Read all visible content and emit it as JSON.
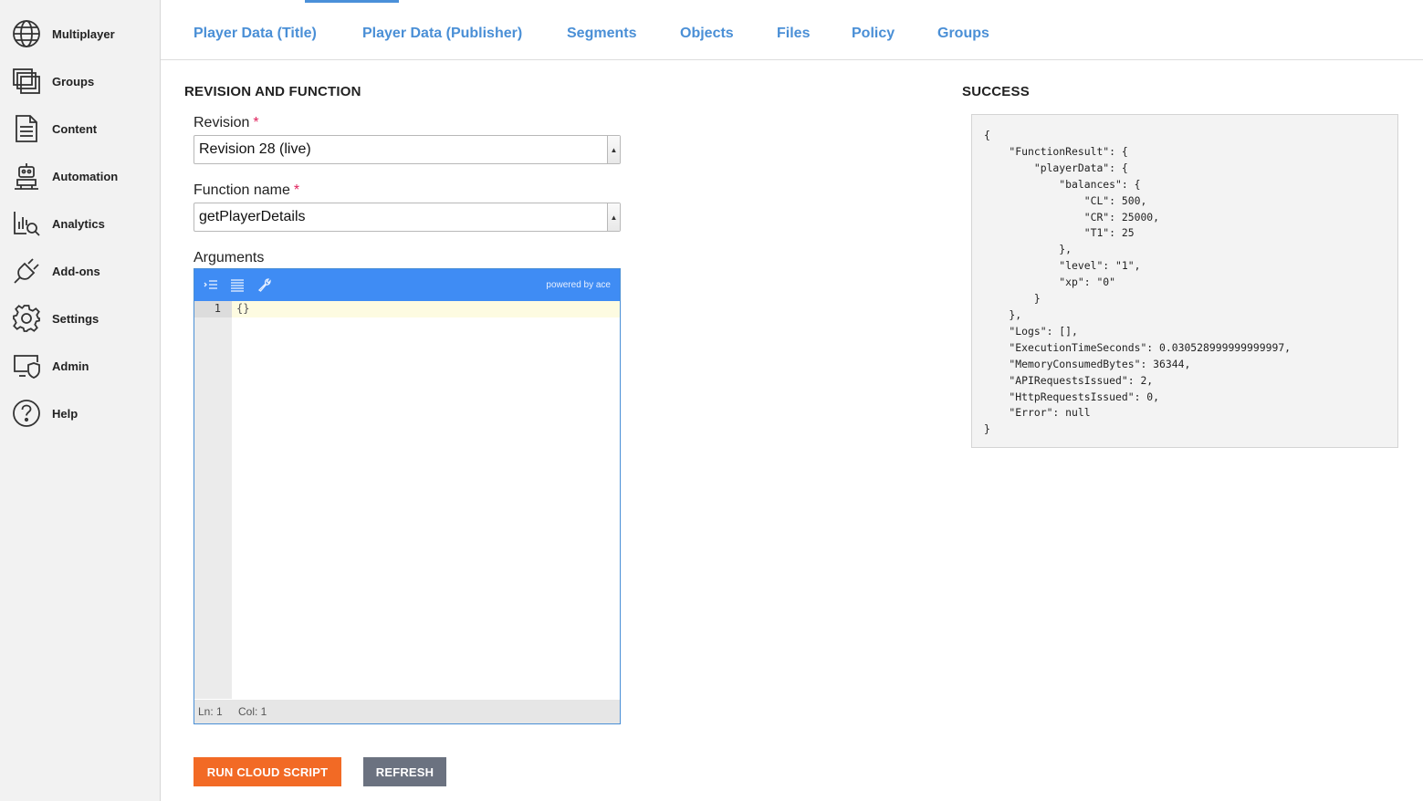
{
  "sidebar": {
    "items": [
      {
        "label": "Multiplayer",
        "icon": "globe-icon"
      },
      {
        "label": "Groups",
        "icon": "stacked-windows-icon"
      },
      {
        "label": "Content",
        "icon": "document-icon"
      },
      {
        "label": "Automation",
        "icon": "robot-icon"
      },
      {
        "label": "Analytics",
        "icon": "chart-magnifier-icon"
      },
      {
        "label": "Add-ons",
        "icon": "plug-icon"
      },
      {
        "label": "Settings",
        "icon": "gear-icon"
      },
      {
        "label": "Admin",
        "icon": "monitor-shield-icon"
      },
      {
        "label": "Help",
        "icon": "question-circle-icon"
      }
    ]
  },
  "tabs": [
    {
      "label": "Player Data (Title)"
    },
    {
      "label": "Player Data (Publisher)"
    },
    {
      "label": "Segments"
    },
    {
      "label": "Objects"
    },
    {
      "label": "Files"
    },
    {
      "label": "Policy"
    },
    {
      "label": "Groups"
    }
  ],
  "form": {
    "section_title": "REVISION AND FUNCTION",
    "revision_label": "Revision",
    "revision_value": "Revision 28 (live)",
    "function_label": "Function name",
    "function_value": "getPlayerDetails",
    "required_mark": "*",
    "arguments_label": "Arguments"
  },
  "editor": {
    "powered_by": "powered by ace",
    "line_number": "1",
    "content": "{}",
    "status_line": "Ln: 1",
    "status_col": "Col: 1"
  },
  "buttons": {
    "run_label": "RUN CLOUD SCRIPT",
    "refresh_label": "REFRESH"
  },
  "result": {
    "title": "SUCCESS",
    "json_text": "{\n    \"FunctionResult\": {\n        \"playerData\": {\n            \"balances\": {\n                \"CL\": 500,\n                \"CR\": 25000,\n                \"T1\": 25\n            },\n            \"level\": \"1\",\n            \"xp\": \"0\"\n        }\n    },\n    \"Logs\": [],\n    \"ExecutionTimeSeconds\": 0.030528999999999997,\n    \"MemoryConsumedBytes\": 36344,\n    \"APIRequestsIssued\": 2,\n    \"HttpRequestsIssued\": 0,\n    \"Error\": null\n}"
  },
  "colors": {
    "accent": "#4a8fd6",
    "run_button": "#f26a25",
    "refresh_button": "#6b7280",
    "editor_toolbar": "#3f8cf4",
    "required": "#e0245e"
  }
}
